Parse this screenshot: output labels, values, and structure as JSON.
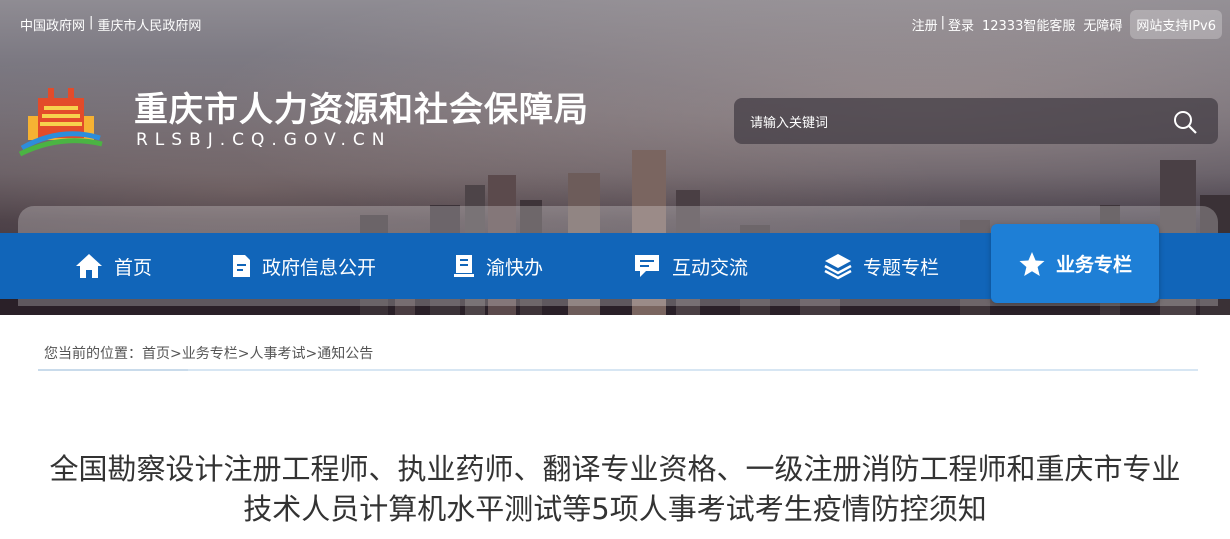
{
  "top_links": {
    "gov": "中国政府网",
    "separator": "|",
    "city_gov": "重庆市人民政府网"
  },
  "top_right": {
    "register": "注册",
    "separator": "|",
    "login": "登录",
    "service": "12333智能客服",
    "accessibility": "无障碍",
    "ipv6": "网站支持IPv6"
  },
  "header": {
    "title": "重庆市人力资源和社会保障局",
    "domain": "RLSBJ.CQ.GOV.CN"
  },
  "search": {
    "placeholder": "请输入关键词"
  },
  "nav": {
    "items": [
      {
        "label": "首页",
        "icon": "home-icon"
      },
      {
        "label": "政府信息公开",
        "icon": "document-icon"
      },
      {
        "label": "渝快办",
        "icon": "book-icon"
      },
      {
        "label": "互动交流",
        "icon": "chat-icon"
      },
      {
        "label": "专题专栏",
        "icon": "layers-icon"
      },
      {
        "label": "业务专栏",
        "icon": "star-icon",
        "active": true
      }
    ]
  },
  "breadcrumb": {
    "prefix": "您当前的位置：",
    "items": [
      "首页",
      "业务专栏",
      "人事考试",
      "通知公告"
    ],
    "separator": ">"
  },
  "article": {
    "title": "全国勘察设计注册工程师、执业药师、翻译专业资格、一级注册消防工程师和重庆市专业技术人员计算机水平测试等5项人事考试考生疫情防控须知"
  },
  "colors": {
    "nav_blue": "#1165b9",
    "nav_active": "#1e7fd6",
    "title_text": "#333333"
  }
}
